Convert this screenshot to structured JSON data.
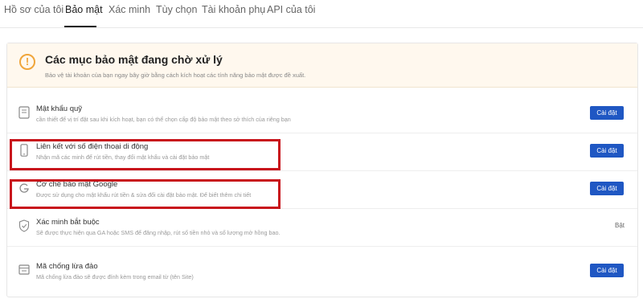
{
  "tabs": [
    {
      "label": "Hồ sơ của tôi"
    },
    {
      "label": "Bảo mật"
    },
    {
      "label": "Xác minh"
    },
    {
      "label": "Tùy chọn"
    },
    {
      "label": "Tài khoản phụ"
    },
    {
      "label": "API của tôi"
    }
  ],
  "active_tab": "Bảo mật",
  "pending": {
    "title": "Các mục bảo mật đang chờ xử lý",
    "description": "Bảo vệ tài khoản của bạn ngay bây giờ bằng cách kích hoạt các tính năng bảo mật được đề xuất."
  },
  "items": [
    {
      "title": "Mật khẩu quỹ",
      "description": "cần thiết để vị trí đặt sau khi kích hoạt, bạn có thể chọn cấp độ bảo mật theo sở thích của riêng bạn",
      "action": "Cài đặt",
      "icon": "key-icon"
    },
    {
      "title": "Liên kết với số điện thoại di động",
      "description": "Nhận mã các minh để rút tiền, thay đổi mật khẩu và cài đặt bảo mật",
      "action": "Cài đặt",
      "icon": "phone-icon"
    },
    {
      "title": "Cơ chế bảo mật Google",
      "description": "Được sử dụng cho mật khẩu rút tiền & sửa đổi cài đặt bảo mật. Để biết thêm chi tiết",
      "action": "Cài đặt",
      "icon": "google-icon"
    },
    {
      "title": "Xác minh bắt buộc",
      "description": "Sẽ được thực hiện qua GA hoặc SMS để đăng nhập, rút số tiền nhỏ và số lượng mở hồng bao.",
      "status": "Bật",
      "icon": "shield-icon"
    },
    {
      "title": "Mã chống lừa đảo",
      "description": "Mã chống lừa đảo sẽ được đính kèm trong email từ (tên Site)",
      "action": "Cài đặt",
      "icon": "anti-phishing-icon"
    }
  ],
  "colors": {
    "accent": "#1f57c3",
    "warning": "#f0a53a",
    "highlight": "#c8141c"
  }
}
